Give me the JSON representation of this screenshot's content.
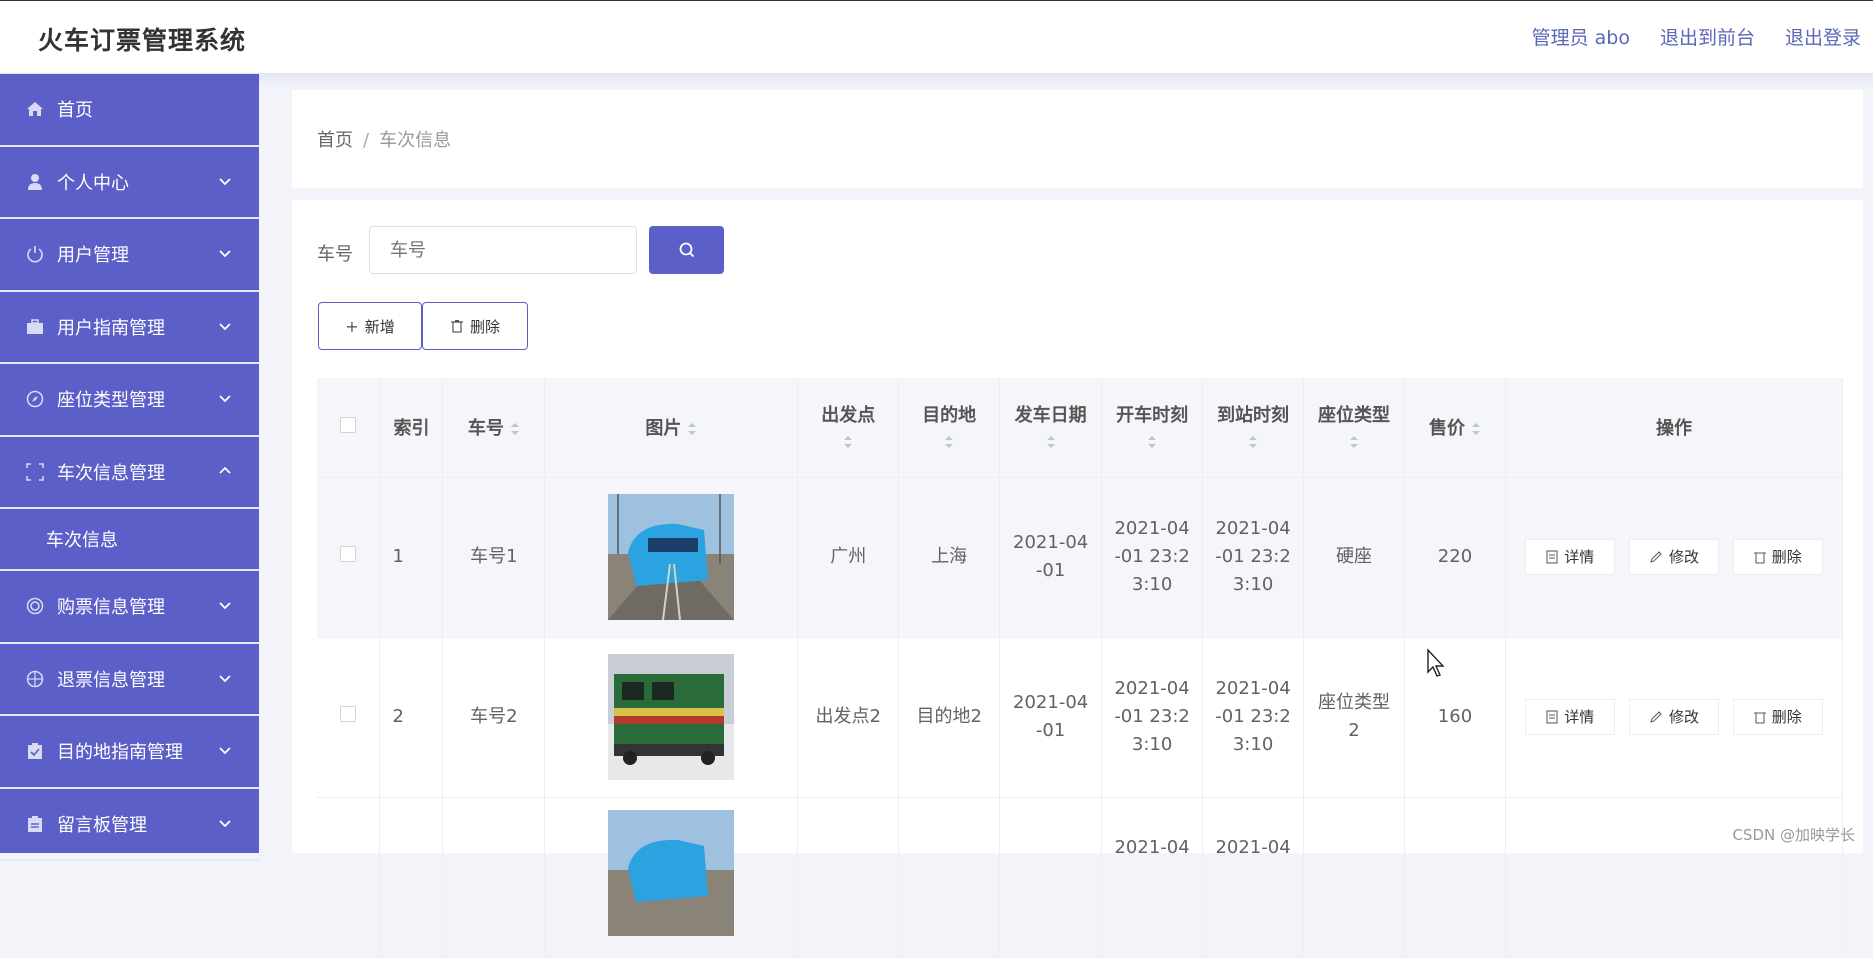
{
  "app": {
    "title": "火车订票管理系统"
  },
  "header_links": {
    "admin": "管理员 abo",
    "front": "退出到前台",
    "logout": "退出登录"
  },
  "sidebar": {
    "items": [
      {
        "label": "首页",
        "icon": "home-icon"
      },
      {
        "label": "个人中心",
        "icon": "user-icon"
      },
      {
        "label": "用户管理",
        "icon": "power-icon"
      },
      {
        "label": "用户指南管理",
        "icon": "briefcase-icon"
      },
      {
        "label": "座位类型管理",
        "icon": "compass-icon"
      },
      {
        "label": "车次信息管理",
        "icon": "frame-icon"
      },
      {
        "label": "购票信息管理",
        "icon": "circle-icon"
      },
      {
        "label": "退票信息管理",
        "icon": "target-icon"
      },
      {
        "label": "目的地指南管理",
        "icon": "clipboard-check-icon"
      },
      {
        "label": "留言板管理",
        "icon": "clipboard-icon"
      }
    ],
    "subitem": "车次信息"
  },
  "breadcrumb": {
    "home": "首页",
    "sep": "/",
    "current": "车次信息"
  },
  "search": {
    "label": "车号",
    "placeholder": "车号"
  },
  "toolbar": {
    "add_label": "新增",
    "delete_label": "删除"
  },
  "table": {
    "headers": [
      "索引",
      "车号",
      "图片",
      "出发点",
      "目的地",
      "发车日期",
      "开车时刻",
      "到站时刻",
      "座位类型",
      "售价",
      "操作"
    ],
    "rows": [
      {
        "index": "1",
        "train_no": "车号1",
        "from": "广州",
        "to": "上海",
        "date": "2021-04-01",
        "depart": "2021-04-01 23:23:10",
        "arrive": "2021-04-01 23:23:10",
        "seat": "硬座",
        "price": "220"
      },
      {
        "index": "2",
        "train_no": "车号2",
        "from": "出发点2",
        "to": "目的地2",
        "date": "2021-04-01",
        "depart": "2021-04-01 23:23:10",
        "arrive": "2021-04-01 23:23:10",
        "seat": "座位类型2",
        "price": "160"
      }
    ],
    "partial_row": {
      "depart": "2021-04",
      "arrive": "2021-04"
    },
    "actions": {
      "detail": "详情",
      "edit": "修改",
      "delete": "删除"
    }
  },
  "watermark": "CSDN @加映学长",
  "colors": {
    "primary": "#5b5fc7",
    "header_link": "#5b67b8"
  }
}
